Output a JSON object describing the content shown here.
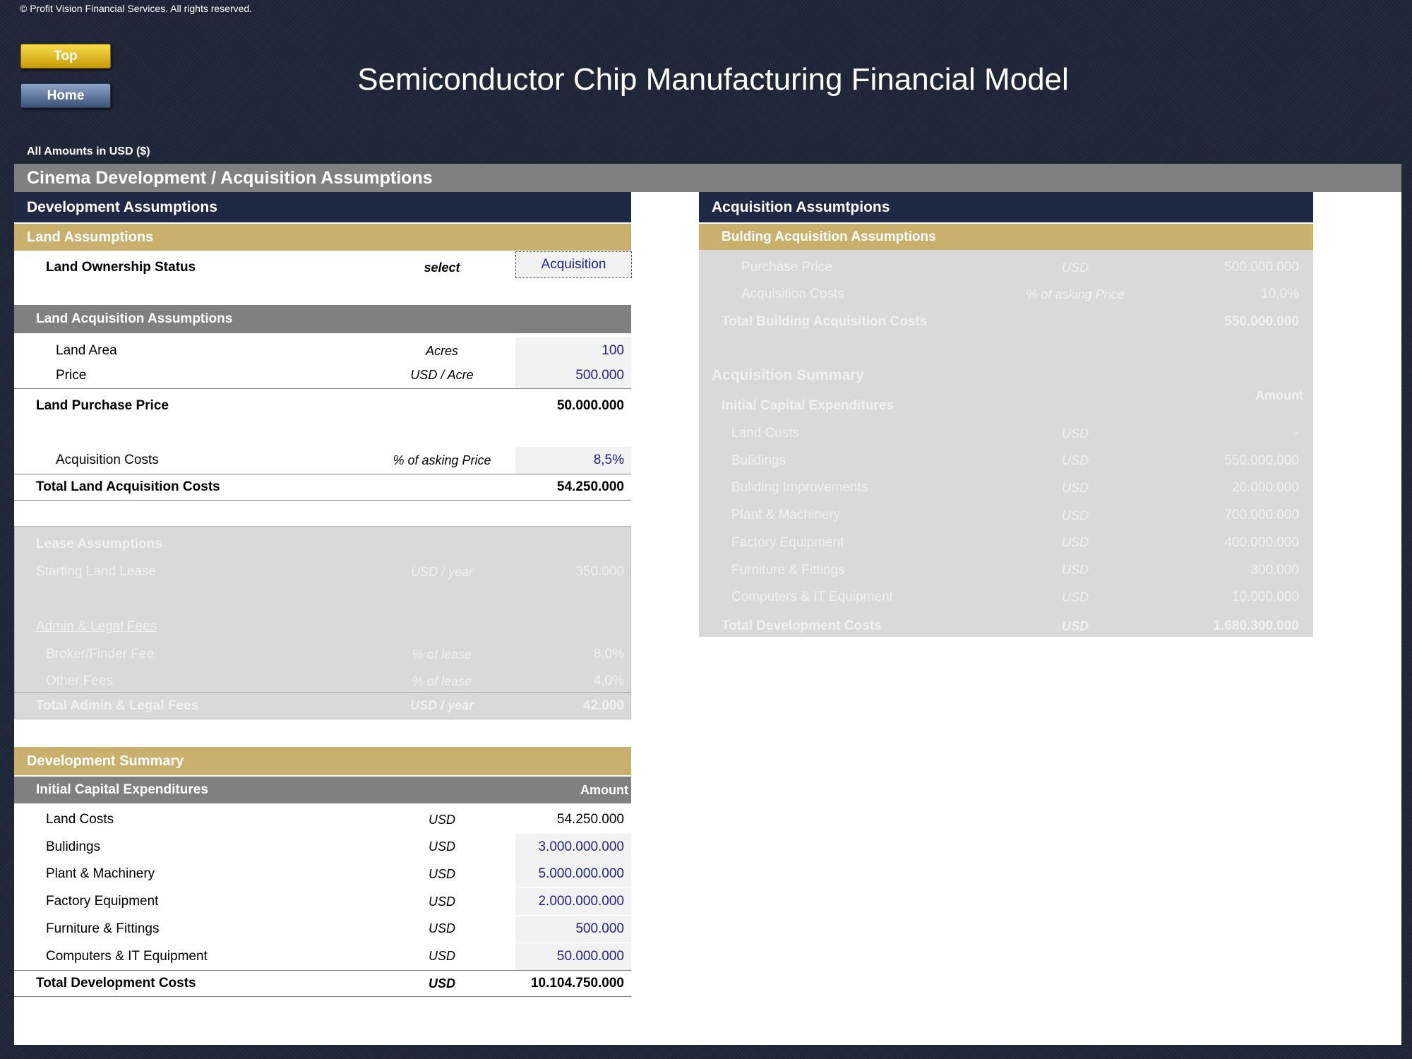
{
  "copyright": "© Profit Vision Financial Services. All rights reserved.",
  "nav": {
    "top_label": "Top",
    "home_label": "Home"
  },
  "title": "Semiconductor Chip Manufacturing Financial Model",
  "amounts_note": "All Amounts in  USD ($)",
  "section_title": "Cinema Development / Acquisition Assumptions",
  "development": {
    "header": "Development Assumptions",
    "land": {
      "header": "Land Assumptions",
      "ownership_label": "Land Ownership Status",
      "ownership_unit": "select",
      "ownership_value": "Acquisition"
    },
    "land_acq": {
      "header": "Land Acquisition Assumptions",
      "area_label": "Land Area",
      "area_unit": "Acres",
      "area_value": "100",
      "price_label": "Price",
      "price_unit": "USD / Acre",
      "price_value": "500.000",
      "purchase_label": "Land Purchase Price",
      "purchase_value": "50.000.000",
      "costs_label": "Acquisition Costs",
      "costs_unit": "% of asking Price",
      "costs_value": "8,5%",
      "total_label": "Total Land Acquisition Costs",
      "total_value": "54.250.000"
    },
    "lease": {
      "header": "Lease Assumptions",
      "start_label": "Starting Land Lease",
      "start_unit": "USD / year",
      "start_value": "350.000",
      "admin_header": "Admin & Legal Fees",
      "broker_label": "Broker/Finder Fee",
      "broker_unit": "% of lease",
      "broker_value": "8,0%",
      "other_label": "Other Fees",
      "other_unit": "% of lease",
      "other_value": "4,0%",
      "total_label": "Total Admin & Legal Fees",
      "total_unit": "USD / year",
      "total_value": "42.000"
    },
    "summary": {
      "header": "Development Summary",
      "sub_header": "Initial Capital Expenditures",
      "amount_header": "Amount",
      "rows": [
        {
          "label": "Land Costs",
          "unit": "USD",
          "value": "54.250.000"
        },
        {
          "label": "Bulidings",
          "unit": "USD",
          "value": "3.000.000.000"
        },
        {
          "label": "Plant & Machinery",
          "unit": "USD",
          "value": "5.000.000.000"
        },
        {
          "label": "Factory Equipment",
          "unit": "USD",
          "value": "2.000.000.000"
        },
        {
          "label": "Furniture & Fittings",
          "unit": "USD",
          "value": "500.000"
        },
        {
          "label": "Computers & IT Equipment",
          "unit": "USD",
          "value": "50.000.000"
        }
      ],
      "total_label": "Total Development Costs",
      "total_unit": "USD",
      "total_value": "10.104.750.000"
    }
  },
  "acquisition": {
    "header": "Acquisition Assumtpions",
    "building": {
      "header": "Bulding Acquisition Assumptions",
      "price_label": "Purchase Price",
      "price_unit": "USD",
      "price_value": "500.000.000",
      "costs_label": "Acquisition Costs",
      "costs_unit": "% of asking Price",
      "costs_value": "10,0%",
      "total_label": "Total Building Acquisition Costs",
      "total_value": "550.000.000"
    },
    "summary": {
      "header": "Acquisition Summary",
      "sub_header": "Initial Capital Expenditures",
      "amount_header": "Amount",
      "rows": [
        {
          "label": "Land Costs",
          "unit": "USD",
          "value": "-"
        },
        {
          "label": "Bulidings",
          "unit": "USD",
          "value": "550.000.000"
        },
        {
          "label": "Buliding Improvements",
          "unit": "USD",
          "value": "20.000.000"
        },
        {
          "label": "Plant & Machinery",
          "unit": "USD",
          "value": "700.000.000"
        },
        {
          "label": "Factory Equipment",
          "unit": "USD",
          "value": "400.000.000"
        },
        {
          "label": "Furniture & Fittings",
          "unit": "USD",
          "value": "300.000"
        },
        {
          "label": "Computers & IT Equipment",
          "unit": "USD",
          "value": "10.000.000"
        }
      ],
      "total_label": "Total Development Costs",
      "total_unit": "USD",
      "total_value": "1.680.300.000"
    }
  }
}
